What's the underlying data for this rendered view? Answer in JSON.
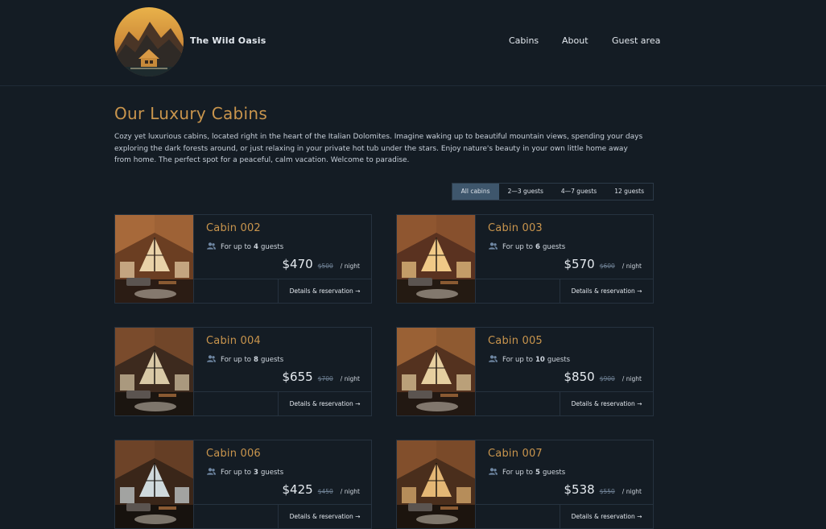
{
  "header": {
    "brand": "The Wild Oasis",
    "nav": [
      "Cabins",
      "About",
      "Guest area"
    ]
  },
  "main": {
    "title": "Our Luxury Cabins",
    "intro": "Cozy yet luxurious cabins, located right in the heart of the Italian Dolomites. Imagine waking up to beautiful mountain views, spending your days exploring the dark forests around, or just relaxing in your private hot tub under the stars. Enjoy nature's beauty in your own little home away from home. The perfect spot for a peaceful, calm vacation. Welcome to paradise."
  },
  "filter": {
    "options": [
      "All cabins",
      "2—3 guests",
      "4—7 guests",
      "12 guests"
    ],
    "active": "All cabins"
  },
  "cabins": [
    {
      "name": "Cabin 002",
      "guests_prefix": "For up to",
      "guests": "4",
      "guests_suffix": "guests",
      "price": "$470",
      "old_price": "$500",
      "per": "/ night",
      "cta": "Details & reservation →"
    },
    {
      "name": "Cabin 003",
      "guests_prefix": "For up to",
      "guests": "6",
      "guests_suffix": "guests",
      "price": "$570",
      "old_price": "$600",
      "per": "/ night",
      "cta": "Details & reservation →"
    },
    {
      "name": "Cabin 004",
      "guests_prefix": "For up to",
      "guests": "8",
      "guests_suffix": "guests",
      "price": "$655",
      "old_price": "$700",
      "per": "/ night",
      "cta": "Details & reservation →"
    },
    {
      "name": "Cabin 005",
      "guests_prefix": "For up to",
      "guests": "10",
      "guests_suffix": "guests",
      "price": "$850",
      "old_price": "$900",
      "per": "/ night",
      "cta": "Details & reservation →"
    },
    {
      "name": "Cabin 006",
      "guests_prefix": "For up to",
      "guests": "3",
      "guests_suffix": "guests",
      "price": "$425",
      "old_price": "$450",
      "per": "/ night",
      "cta": "Details & reservation →"
    },
    {
      "name": "Cabin 007",
      "guests_prefix": "For up to",
      "guests": "5",
      "guests_suffix": "guests",
      "price": "$538",
      "old_price": "$550",
      "per": "/ night",
      "cta": "Details & reservation →"
    }
  ],
  "colors": {
    "background": "#141c24",
    "accent": "#c9954d",
    "active_filter": "#3e566c",
    "border": "#26323f",
    "icon": "#6f87a3"
  },
  "icons": {
    "guests": "users-icon",
    "logo": "mountain-cabin-logo"
  }
}
